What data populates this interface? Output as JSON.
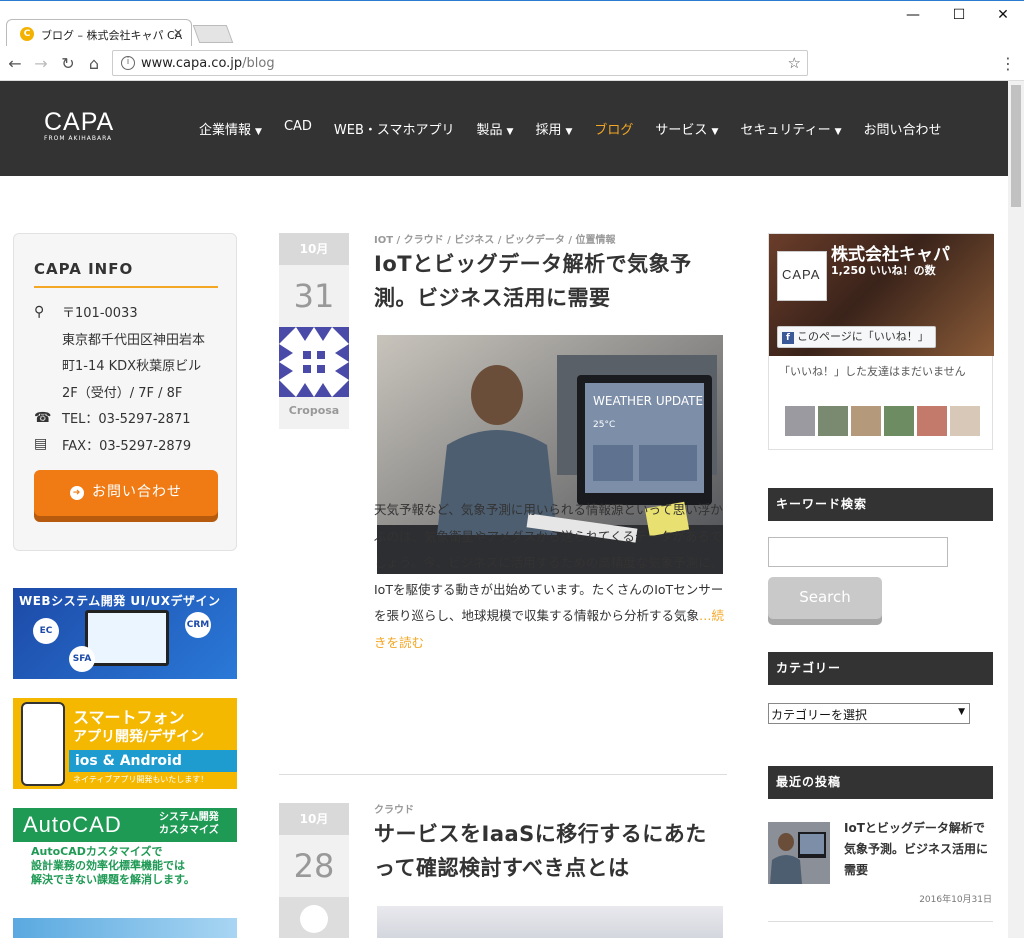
{
  "browser": {
    "tab_title": "ブログ – 株式会社キャパ CA",
    "tab_favicon": "C",
    "url_host": "www.capa.co.jp",
    "url_path": "/blog"
  },
  "site": {
    "logo_main": "CAPA",
    "logo_sub": "FROM AKIHABARA",
    "nav": [
      {
        "label": "企業情報",
        "dropdown": true
      },
      {
        "label": "CAD",
        "dropdown": false
      },
      {
        "label": "WEB・スマホアプリ",
        "dropdown": false
      },
      {
        "label": "製品",
        "dropdown": true
      },
      {
        "label": "採用",
        "dropdown": true
      },
      {
        "label": "ブログ",
        "dropdown": false,
        "active": true
      },
      {
        "label": "サービス",
        "dropdown": true
      },
      {
        "label": "セキュリティー",
        "dropdown": true
      },
      {
        "label": "お問い合わせ",
        "dropdown": false
      }
    ],
    "accent_color": "#f3a724"
  },
  "info": {
    "title": "CAPA INFO",
    "postal": "〒101-0033",
    "address_lines": [
      "東京都千代田区神田岩本",
      "町1-14 KDX秋葉原ビル",
      "2F（受付）/ 7F / 8F"
    ],
    "tel": "TEL：03-5297-2871",
    "fax": "FAX：03-5297-2879",
    "contact_button": "お問い合わせ"
  },
  "banners": {
    "web": {
      "title": "WEBシステム開発 UI/UXデザイン",
      "bubbles": [
        "EC",
        "CRM",
        "SFA"
      ]
    },
    "smart": {
      "line1": "スマートフォン",
      "line2": "アプリ開発/デザイン",
      "bar": "ios & Android",
      "note": "ネイティブアプリ開発もいたします！"
    },
    "autocad": {
      "title": "AutoCAD",
      "sub1": "システム開発",
      "sub2": "カスタマイズ",
      "body": [
        "AutoCADカスタマイズで",
        "設計業務の効率化標準機能では",
        "解決できない課題を解消します。"
      ]
    }
  },
  "posts": [
    {
      "month": "10月",
      "day": "31",
      "author": "Croposa",
      "categories": "IOT / クラウド / ビジネス / ビックデータ / 位置情報",
      "title": "IoTとビッグデータ解析で気象予測。ビジネス活用に需要",
      "image_text": "WEATHER UPDATE",
      "image_temp": "25°C",
      "excerpt": "天気予報など、気象予測に用いられる情報源といって思い浮かぶのは、気象衛星やアメダスから送られてくるデータがあるでしょう。今、ビジネスに活用するための高精度な気象予測に、IoTを駆使する動きが出始めています。たくさんのIoTセンサーを張り巡らし、地球規模で収集する情報から分析する気象",
      "more": "…続きを読む"
    },
    {
      "month": "10月",
      "day": "28",
      "categories": "クラウド",
      "title": "サービスをIaaSに移行するにあたって確認検討すべき点とは"
    }
  ],
  "facebook": {
    "page_name": "株式会社キャパ",
    "likes": "1,250 いいね！の数",
    "like_button": "このページに「いいね！」",
    "friends_text": "「いいね！」した友達はまだいません"
  },
  "widgets": {
    "search_title": "キーワード検索",
    "search_button": "Search",
    "category_title": "カテゴリー",
    "category_select": "カテゴリーを選択",
    "recent_title": "最近の投稿"
  },
  "recent": {
    "title": "IoTとビッグデータ解析で気象予測。ビジネス活用に需要",
    "date": "2016年10月31日"
  }
}
